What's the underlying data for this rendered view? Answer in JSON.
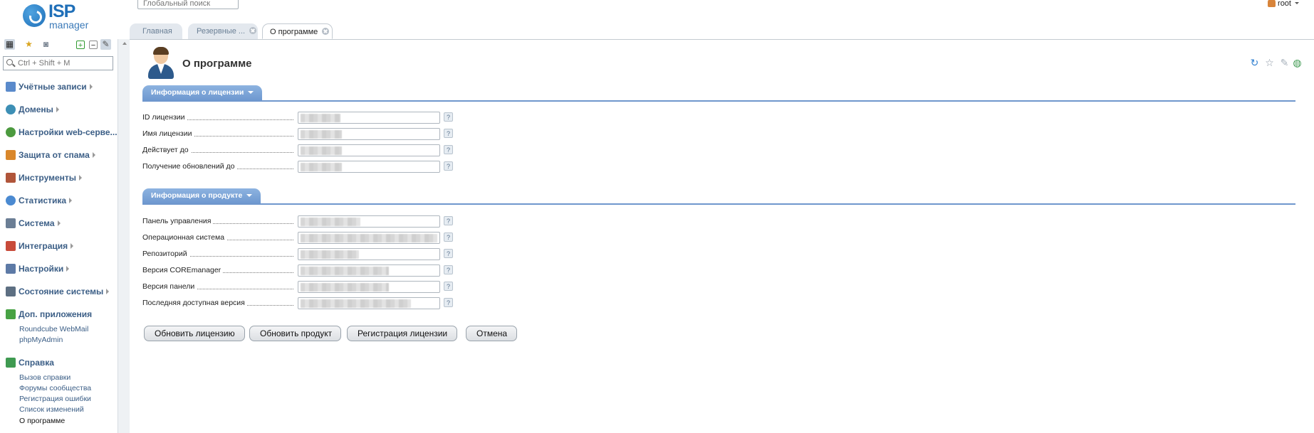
{
  "logo": {
    "brand": "ISP",
    "product": "manager"
  },
  "sidebar": {
    "search_placeholder": "Ctrl + Shift + M",
    "items": [
      {
        "label": "Учётные записи",
        "icon": "users-icon",
        "color": "#5a8acb"
      },
      {
        "label": "Домены",
        "icon": "globe-icon",
        "color": "#3d8fb5"
      },
      {
        "label": "Настройки web-серве...",
        "icon": "web-settings-icon",
        "color": "#4c9a3f"
      },
      {
        "label": "Защита от спама",
        "icon": "shield-icon",
        "color": "#d9872b"
      },
      {
        "label": "Инструменты",
        "icon": "tools-icon",
        "color": "#b0553a"
      },
      {
        "label": "Статистика",
        "icon": "stats-globe-icon",
        "color": "#4b8ad1"
      },
      {
        "label": "Система",
        "icon": "system-icon",
        "color": "#6b7e95"
      },
      {
        "label": "Интеграция",
        "icon": "integration-icon",
        "color": "#c84b3a"
      },
      {
        "label": "Настройки",
        "icon": "settings-icon",
        "color": "#5d7aa6"
      },
      {
        "label": "Состояние системы",
        "icon": "monitor-icon",
        "color": "#5d6f82"
      },
      {
        "label": "Доп. приложения",
        "icon": "plus-icon",
        "color": "#47a244"
      },
      {
        "label": "Справка",
        "icon": "help-book-icon",
        "color": "#3f9a51"
      }
    ],
    "apps": [
      "Roundcube WebMail",
      "phpMyAdmin"
    ],
    "help_items": [
      "Вызов справки",
      "Форумы сообщества",
      "Регистрация ошибки",
      "Список изменений",
      "О программе"
    ]
  },
  "topbar": {
    "global_search_placeholder": "Глобальный поиск",
    "user": "root"
  },
  "tabs": [
    {
      "label": "Главная",
      "closable": false
    },
    {
      "label": "Резервные ...",
      "closable": true
    },
    {
      "label": "О программе",
      "closable": true,
      "active": true
    }
  ],
  "page": {
    "title": "О программе"
  },
  "license": {
    "section_label": "Информация о лицензии",
    "rows": [
      {
        "label": "ID лицензии"
      },
      {
        "label": "Имя лицензии"
      },
      {
        "label": "Действует до"
      },
      {
        "label": "Получение обновлений до"
      }
    ]
  },
  "product": {
    "section_label": "Информация о продукте",
    "rows": [
      {
        "label": "Панель управления"
      },
      {
        "label": "Операционная система"
      },
      {
        "label": "Репозиторий"
      },
      {
        "label": "Версия COREmanager"
      },
      {
        "label": "Версия панели"
      },
      {
        "label": "Последняя доступная версия"
      }
    ]
  },
  "help_mark": "?",
  "buttons": {
    "update_license": "Обновить лицензию",
    "update_product": "Обновить продукт",
    "register_license": "Регистрация лицензии",
    "cancel": "Отмена"
  },
  "colors": {
    "accent": "#6f97cd",
    "link": "#3b5e86"
  }
}
